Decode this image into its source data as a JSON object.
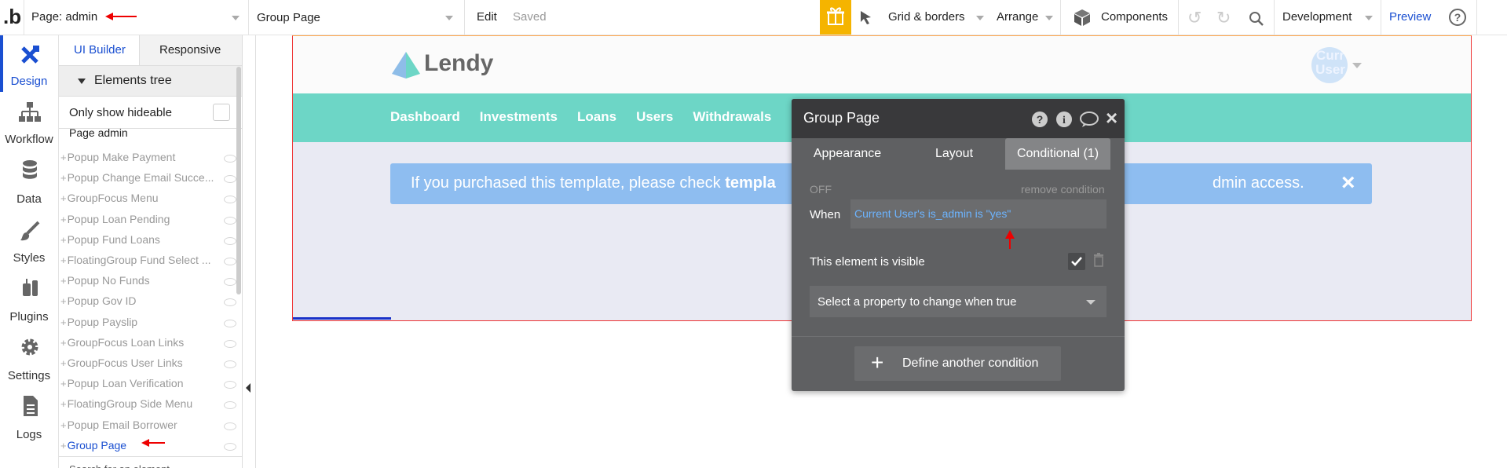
{
  "topbar": {
    "page_label": "Page: admin",
    "element_select": "Group Page",
    "edit": "Edit",
    "saved": "Saved",
    "grid": "Grid & borders",
    "arrange": "Arrange",
    "components": "Components",
    "development": "Development",
    "preview": "Preview"
  },
  "rail": {
    "design": "Design",
    "workflow": "Workflow",
    "data": "Data",
    "styles": "Styles",
    "plugins": "Plugins",
    "settings": "Settings",
    "logs": "Logs"
  },
  "panel": {
    "tab_ui_builder": "UI Builder",
    "tab_responsive": "Responsive",
    "tree_title": "Elements tree",
    "only_hideable": "Only show hideable",
    "root": "Page admin",
    "items": [
      "Popup Make Payment",
      "Popup Change Email Succe...",
      "GroupFocus Menu",
      "Popup Loan Pending",
      "Popup Fund Loans",
      "FloatingGroup Fund Select ...",
      "Popup No Funds",
      "Popup Gov ID",
      "Popup Payslip",
      "GroupFocus Loan Links",
      "GroupFocus User Links",
      "Popup Loan Verification",
      "FloatingGroup Side Menu",
      "Popup Email Borrower",
      "Group Page"
    ],
    "search_partial": "Search for an element"
  },
  "app": {
    "brand": "Lendy",
    "avatar_text": "Curr User",
    "nav": [
      "Dashboard",
      "Investments",
      "Loans",
      "Users",
      "Withdrawals"
    ],
    "banner_prefix": "If you purchased this template, please check ",
    "banner_bold": "templa",
    "banner_suffix": "dmin access.",
    "banner_close": "×"
  },
  "dialog": {
    "title": "Group Page",
    "tabs": [
      "Appearance",
      "Layout",
      "Conditional (1)"
    ],
    "off": "OFF",
    "remove": "remove condition",
    "when_label": "When",
    "expression": "Current User's is_admin is \"yes\"",
    "visible_label": "This element is visible",
    "select_property": "Select a property to change when true",
    "define_another": "Define another condition"
  },
  "colors": {
    "accent": "#1a4fd1",
    "teal": "#6dd6c6",
    "banner": "#8ebdf0",
    "toolbar_gift": "#f5b400",
    "link_blue": "#6cb4ff"
  }
}
